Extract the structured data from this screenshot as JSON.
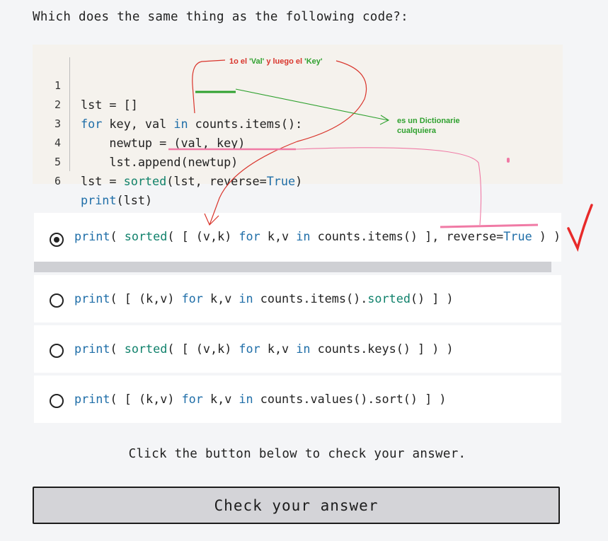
{
  "question": "Which does the same thing as the following code?:",
  "code": {
    "lines": [
      {
        "num": "1",
        "tokens": [
          {
            "t": "lst = []",
            "c": "p"
          }
        ]
      },
      {
        "num": "2",
        "tokens": [
          {
            "t": "for",
            "c": "k"
          },
          {
            "t": " key, val ",
            "c": "p"
          },
          {
            "t": "in",
            "c": "k"
          },
          {
            "t": " counts.items():",
            "c": "p"
          }
        ]
      },
      {
        "num": "3",
        "tokens": [
          {
            "t": "    newtup = (val, key)",
            "c": "p"
          }
        ]
      },
      {
        "num": "4",
        "tokens": [
          {
            "t": "    lst.append(newtup)",
            "c": "p"
          }
        ]
      },
      {
        "num": "5",
        "tokens": [
          {
            "t": "lst = ",
            "c": "p"
          },
          {
            "t": "sorted",
            "c": "v"
          },
          {
            "t": "(lst, reverse=",
            "c": "p"
          },
          {
            "t": "True",
            "c": "k"
          },
          {
            "t": ")",
            "c": "p"
          }
        ]
      },
      {
        "num": "6",
        "tokens": [
          {
            "t": "print",
            "c": "k"
          },
          {
            "t": "(lst)",
            "c": "p"
          }
        ]
      }
    ]
  },
  "options": [
    {
      "checked": true,
      "tokens": [
        {
          "t": "print",
          "c": "k"
        },
        {
          "t": "( ",
          "c": "p"
        },
        {
          "t": "sorted",
          "c": "v"
        },
        {
          "t": "( [ (v,k) ",
          "c": "p"
        },
        {
          "t": "for",
          "c": "k"
        },
        {
          "t": " k,v ",
          "c": "p"
        },
        {
          "t": "in",
          "c": "k"
        },
        {
          "t": " counts.items() ], reverse=",
          "c": "p"
        },
        {
          "t": "True",
          "c": "k"
        },
        {
          "t": " ) )",
          "c": "p"
        }
      ]
    },
    {
      "checked": false,
      "tokens": [
        {
          "t": "print",
          "c": "k"
        },
        {
          "t": "( [ (k,v) ",
          "c": "p"
        },
        {
          "t": "for",
          "c": "k"
        },
        {
          "t": " k,v ",
          "c": "p"
        },
        {
          "t": "in",
          "c": "k"
        },
        {
          "t": " counts.items().",
          "c": "p"
        },
        {
          "t": "sorted",
          "c": "v"
        },
        {
          "t": "() ] )",
          "c": "p"
        }
      ]
    },
    {
      "checked": false,
      "tokens": [
        {
          "t": "print",
          "c": "k"
        },
        {
          "t": "( ",
          "c": "p"
        },
        {
          "t": "sorted",
          "c": "v"
        },
        {
          "t": "( [ (v,k) ",
          "c": "p"
        },
        {
          "t": "for",
          "c": "k"
        },
        {
          "t": " k,v ",
          "c": "p"
        },
        {
          "t": "in",
          "c": "k"
        },
        {
          "t": " counts.keys() ] ) )",
          "c": "p"
        }
      ]
    },
    {
      "checked": false,
      "tokens": [
        {
          "t": "print",
          "c": "k"
        },
        {
          "t": "( [ (k,v) ",
          "c": "p"
        },
        {
          "t": "for",
          "c": "k"
        },
        {
          "t": " k,v ",
          "c": "p"
        },
        {
          "t": "in",
          "c": "k"
        },
        {
          "t": " counts.values().sort() ] )",
          "c": "p"
        }
      ]
    }
  ],
  "hint": "Click the button below to check your answer.",
  "check_button": "Check your answer",
  "annotations": {
    "note1_prefix": "1o el ",
    "note1_val": "'Val'",
    "note1_mid": " y luego el ",
    "note1_key": "'Key'",
    "note2_line1": "es un Dictionarie",
    "note2_line2": "cualquiera"
  },
  "colors": {
    "keyword": "#1f6ea8",
    "builtin": "#11826c",
    "annotation_red": "#d9342b",
    "annotation_green": "#2fa12f",
    "annotation_pink": "#f07aa5"
  }
}
